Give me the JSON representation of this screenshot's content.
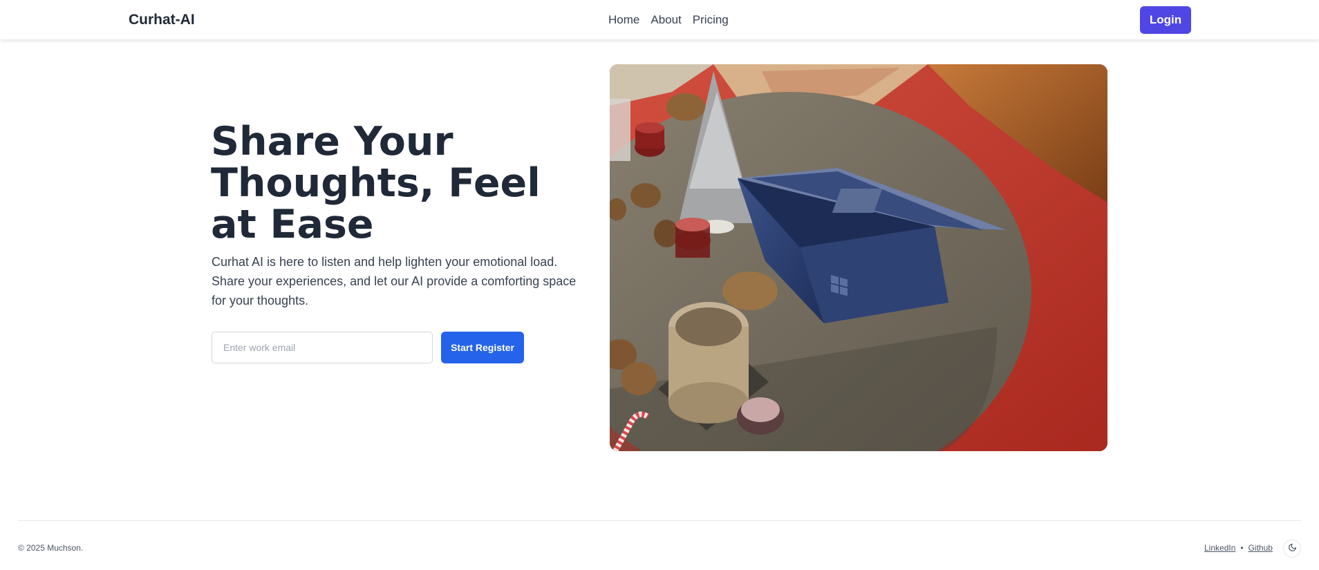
{
  "navbar": {
    "brand": "Curhat-AI",
    "links": [
      {
        "label": "Home"
      },
      {
        "label": "About"
      },
      {
        "label": "Pricing"
      }
    ],
    "login_label": "Login"
  },
  "hero": {
    "title": "Share Your Thoughts, Feel at Ease",
    "description": "Curhat AI is here to listen and help lighten your emotional load. Share your experiences, and let our AI provide a comforting space for your thoughts.",
    "email_placeholder": "Enter work email",
    "email_value": "",
    "register_label": "Start Register"
  },
  "footer": {
    "copyright": "© 2025 Muchson.",
    "links": [
      {
        "label": "LinkedIn"
      },
      {
        "label": "Github"
      }
    ],
    "separator": "•",
    "theme_icon": "moon-icon"
  },
  "colors": {
    "primary_login": "#4f46e5",
    "primary_register": "#2563eb",
    "text_dark": "#1f2937"
  }
}
